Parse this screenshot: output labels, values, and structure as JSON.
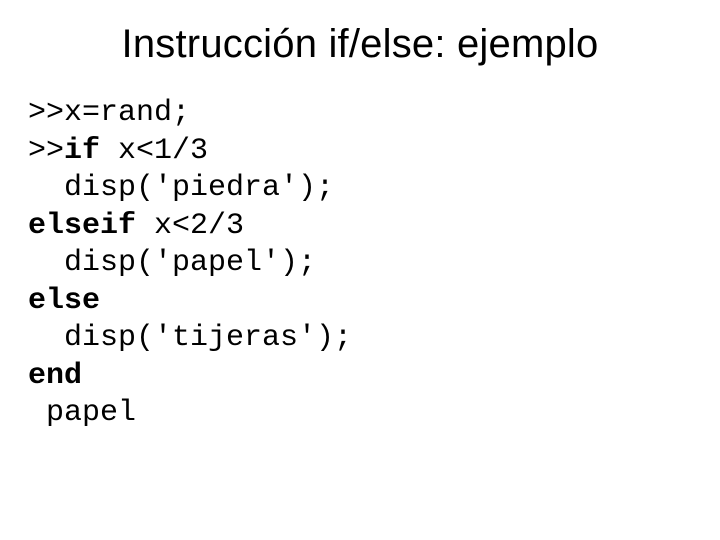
{
  "title": "Instrucción if/else: ejemplo",
  "code": {
    "l1a": ">>",
    "l1b": "x=rand;",
    "l2a": ">>",
    "l2b": "if",
    "l2c": " x<1/3",
    "l3": "  disp('piedra');",
    "l4a": "elseif",
    "l4b": " x<2/3",
    "l5": "  disp('papel');",
    "l6": "else",
    "l7": "  disp('tijeras');",
    "l8": "end",
    "l9": " papel"
  }
}
